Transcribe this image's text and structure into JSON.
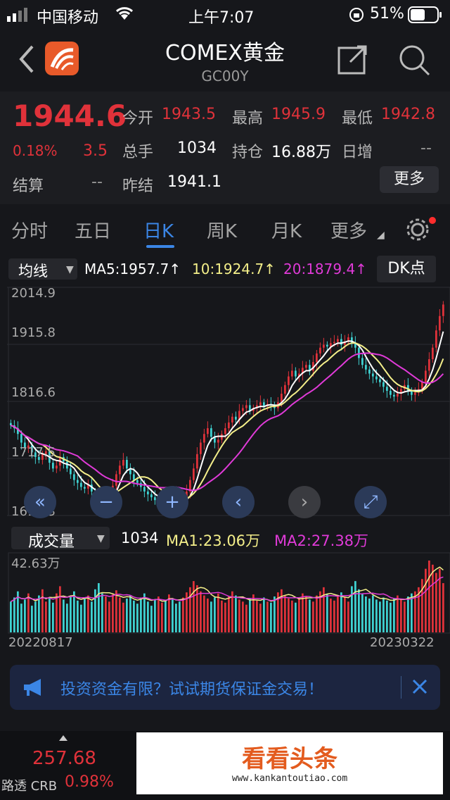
{
  "status_bar": {
    "carrier": "中国移动",
    "time": "上午7:07",
    "battery": "51%"
  },
  "header": {
    "title": "COMEX黄金",
    "subtitle": "GC00Y",
    "back_icon": "chevron-left-icon",
    "share_icon": "share-icon",
    "search_icon": "search-icon"
  },
  "quote": {
    "price": "1944.6",
    "change_pct": "0.18%",
    "change": "3.5",
    "settle_label": "结算",
    "settle_value": "--",
    "open_label": "今开",
    "open_value": "1943.5",
    "high_label": "最高",
    "high_value": "1945.9",
    "low_label": "最低",
    "low_value": "1942.8",
    "volume_label": "总手",
    "volume_value": "1034",
    "position_label": "持仓",
    "position_value": "16.88万",
    "increase_label": "日增",
    "increase_value": "--",
    "prev_label": "昨结",
    "prev_value": "1941.1",
    "more_label": "更多"
  },
  "tabs": [
    {
      "label": "分时"
    },
    {
      "label": "五日"
    },
    {
      "label": "日K"
    },
    {
      "label": "周K"
    },
    {
      "label": "月K"
    },
    {
      "label": "更多"
    }
  ],
  "chart_toolbar": {
    "ma_select": "均线",
    "ma5": "MA5:1957.7↑",
    "ma10": "10:1924.7↑",
    "ma20": "20:1879.4↑",
    "dk_label": "DK点"
  },
  "volume_toolbar": {
    "select": "成交量",
    "value": "1034",
    "ma1": "MA1:23.06万",
    "ma2": "MA2:27.38万"
  },
  "colors": {
    "up": "#e0323a",
    "down": "#3fd2d2",
    "ma5": "#ffffff",
    "ma10": "#f4ef8a",
    "ma20": "#e03ad8",
    "accent": "#3b86e6"
  },
  "chart_data": {
    "type": "candlestick",
    "y_ticks": [
      "2014.9",
      "1915.8",
      "1816.6",
      "1717.5",
      "1618.3"
    ],
    "ylim": [
      1618.3,
      2014.9
    ],
    "volume_max_label": "42.63万",
    "x_start": "20220817",
    "x_end": "20230322",
    "close": [
      1775,
      1770,
      1760,
      1745,
      1735,
      1740,
      1728,
      1720,
      1715,
      1725,
      1730,
      1710,
      1700,
      1705,
      1720,
      1712,
      1700,
      1690,
      1680,
      1675,
      1668,
      1665,
      1672,
      1660,
      1650,
      1640,
      1635,
      1645,
      1660,
      1670,
      1690,
      1705,
      1715,
      1700,
      1690,
      1680,
      1675,
      1668,
      1660,
      1655,
      1650,
      1645,
      1648,
      1652,
      1650,
      1655,
      1648,
      1640,
      1635,
      1645,
      1660,
      1680,
      1700,
      1725,
      1745,
      1760,
      1770,
      1755,
      1745,
      1750,
      1760,
      1770,
      1780,
      1790,
      1785,
      1800,
      1805,
      1810,
      1800,
      1805,
      1810,
      1815,
      1808,
      1812,
      1810,
      1805,
      1815,
      1830,
      1845,
      1860,
      1870,
      1860,
      1865,
      1875,
      1880,
      1870,
      1885,
      1900,
      1910,
      1915,
      1912,
      1918,
      1920,
      1925,
      1915,
      1920,
      1928,
      1918,
      1910,
      1892,
      1880,
      1872,
      1865,
      1860,
      1855,
      1850,
      1842,
      1835,
      1828,
      1825,
      1830,
      1838,
      1845,
      1835,
      1828,
      1832,
      1838,
      1850,
      1870,
      1890,
      1910,
      1940,
      1965,
      1985
    ],
    "volume": [
      0.3,
      0.34,
      0.4,
      0.28,
      0.32,
      0.38,
      0.26,
      0.3,
      0.36,
      0.42,
      0.3,
      0.33,
      0.29,
      0.38,
      0.45,
      0.32,
      0.28,
      0.35,
      0.4,
      0.31,
      0.27,
      0.33,
      0.36,
      0.3,
      0.42,
      0.48,
      0.38,
      0.35,
      0.3,
      0.37,
      0.41,
      0.34,
      0.29,
      0.33,
      0.36,
      0.31,
      0.28,
      0.34,
      0.38,
      0.3,
      0.26,
      0.32,
      0.35,
      0.29,
      0.31,
      0.37,
      0.33,
      0.28,
      0.3,
      0.34,
      0.39,
      0.44,
      0.5,
      0.46,
      0.4,
      0.36,
      0.33,
      0.3,
      0.34,
      0.38,
      0.31,
      0.29,
      0.35,
      0.4,
      0.36,
      0.32,
      0.3,
      0.27,
      0.33,
      0.37,
      0.31,
      0.28,
      0.34,
      0.3,
      0.29,
      0.35,
      0.39,
      0.42,
      0.36,
      0.33,
      0.31,
      0.29,
      0.34,
      0.38,
      0.35,
      0.32,
      0.3,
      0.36,
      0.4,
      0.44,
      0.37,
      0.33,
      0.31,
      0.35,
      0.39,
      0.34,
      0.3,
      0.45,
      0.5,
      0.42,
      0.38,
      0.35,
      0.33,
      0.36,
      0.32,
      0.3,
      0.34,
      0.31,
      0.29,
      0.33,
      0.36,
      0.32,
      0.3,
      0.35,
      0.38,
      0.4,
      0.44,
      0.52,
      0.62,
      0.7,
      0.66,
      0.58,
      0.62,
      0.48
    ]
  },
  "chart_controls": {
    "left_fast_icon": "double-left-icon",
    "zoom_out_icon": "minus-icon",
    "zoom_in_icon": "plus-icon",
    "prev_icon": "chevron-left-icon",
    "next_icon": "chevron-right-icon",
    "fullscreen_icon": "expand-icon"
  },
  "banner": {
    "text": "投资资金有限？试试期货保证金交易！",
    "icon": "megaphone-icon",
    "close_icon": "close-icon"
  },
  "bottom": {
    "price": "257.68",
    "name": "路透 CRB",
    "pct": "0.98%",
    "watermark": "看看头条",
    "watermark_url": "www.kankantoutiao.com"
  }
}
